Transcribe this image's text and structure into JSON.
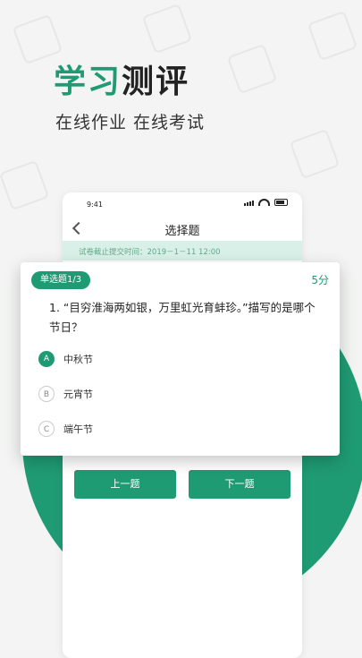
{
  "headline": {
    "accent": "学习",
    "rest": "测评"
  },
  "subline": "在线作业 在线考试",
  "phone": {
    "status_time": "9:41",
    "nav_title": "选择题",
    "deadline": "试卷截止提交时间：2019－1－11 12:00",
    "prev_label": "上一题",
    "next_label": "下一题"
  },
  "question_card": {
    "type_badge": "单选题1/3",
    "points": "5分",
    "question": "1. “目穷淮海两如银，万里虹光育蚌珍。”描写的是哪个节日？",
    "options": [
      {
        "letter": "A",
        "text": "中秋节",
        "selected": true
      },
      {
        "letter": "B",
        "text": "元宵节",
        "selected": false
      },
      {
        "letter": "C",
        "text": "端午节",
        "selected": false
      }
    ]
  },
  "colors": {
    "accent": "#1f9b73",
    "deadline_bg": "#d9f0e8",
    "background": "#f3f4f3"
  },
  "icons": [
    "back-chevron-icon",
    "signal-icon",
    "wifi-icon",
    "battery-icon"
  ]
}
